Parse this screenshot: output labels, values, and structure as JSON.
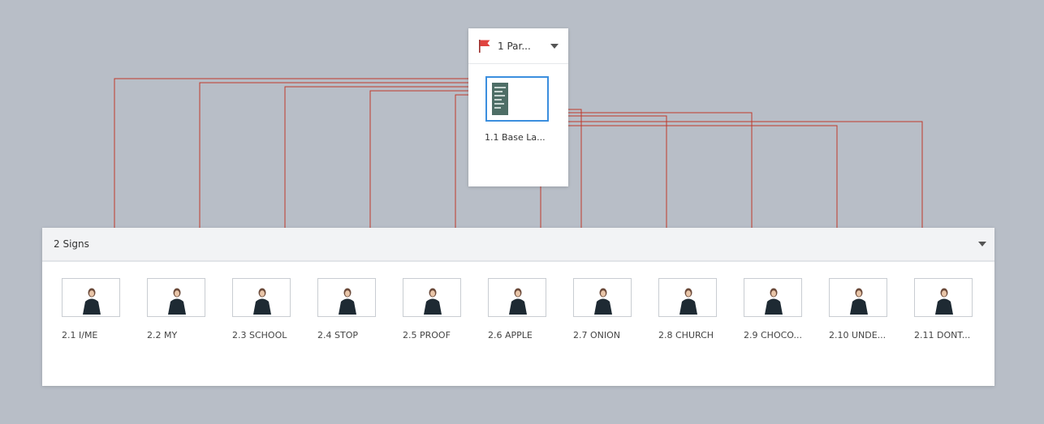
{
  "parent": {
    "title": "1 Par...",
    "flag_color": "#e0433f",
    "base_label": "1.1 Base La..."
  },
  "signs_section": {
    "title": "2 Signs",
    "items": [
      {
        "label": "2.1 I/ME"
      },
      {
        "label": "2.2 MY"
      },
      {
        "label": "2.3 SCHOOL"
      },
      {
        "label": "2.4 STOP"
      },
      {
        "label": "2.5 PROOF"
      },
      {
        "label": "2.6 APPLE"
      },
      {
        "label": "2.7 ONION"
      },
      {
        "label": "2.8 CHURCH"
      },
      {
        "label": "2.9 CHOCO..."
      },
      {
        "label": "2.10 UNDE..."
      },
      {
        "label": "2.11 DONT..."
      }
    ]
  },
  "connector_color": "#c0392b",
  "selection_color": "#3b8ede"
}
